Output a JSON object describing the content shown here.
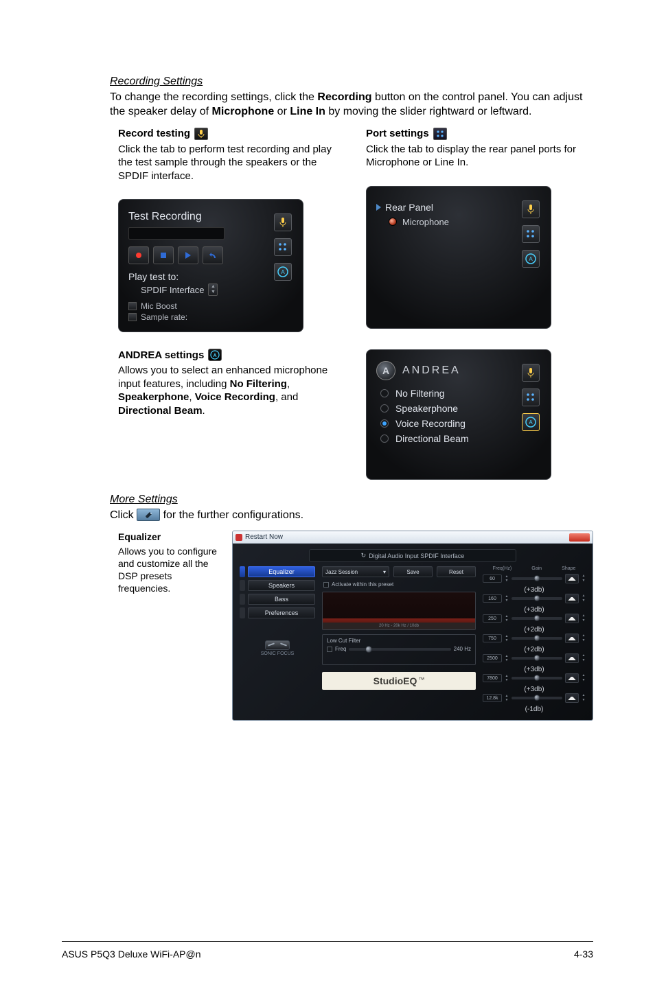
{
  "section1": {
    "title": "Recording Settings",
    "para_pre": "To change the recording settings, click the ",
    "para_b1": "Recording",
    "para_mid1": " button on the control panel. You can adjust the speaker delay of ",
    "para_b2": "Microphone",
    "para_mid2": " or ",
    "para_b3": "Line In",
    "para_post": " by moving the slider rightward or leftward."
  },
  "record": {
    "heading": "Record testing",
    "desc": "Click the tab to perform test recording and play the test sample through the speakers or the SPDIF interface.",
    "panel": {
      "title": "Test Recording",
      "play_label": "Play test to:",
      "play_value": "SPDIF Interface",
      "chk1": "Mic Boost",
      "chk2": "Sample rate:"
    }
  },
  "port": {
    "heading": "Port settings",
    "desc": "Click the tab to display the rear panel ports for Microphone or Line In.",
    "panel": {
      "title": "Rear Panel",
      "item": "Microphone"
    }
  },
  "andrea": {
    "heading": "ANDREA settings",
    "desc_pre": "Allows you to select an enhanced microphone input features, including ",
    "b1": "No Filtering",
    "sep1": ", ",
    "b2": "Speakerphone",
    "sep2": ", ",
    "b3": "Voice Recording",
    "sep3": ", and ",
    "b4": "Directional Beam",
    "post": ".",
    "logo_char": "A",
    "logo_text": "ANDREA",
    "options": [
      "No Filtering",
      "Speakerphone",
      "Voice Recording",
      "Directional Beam"
    ]
  },
  "more": {
    "title": "More Settings",
    "line_pre": "Click ",
    "line_post": " for the further configurations.",
    "eq": {
      "h": "Equalizer",
      "desc": "Allows you to configure and customize all the DSP presets frequencies."
    }
  },
  "eqwin": {
    "title": "Restart Now",
    "strip": "Digital Audio Input SPDIF Interface",
    "tabs": [
      "Equalizer",
      "Speakers",
      "Bass",
      "Preferences"
    ],
    "sonic": "SONIC FOCUS",
    "preset": "Jazz Session",
    "save": "Save",
    "reset": "Reset",
    "activate": "Activate within this preset",
    "axis": "20 Hz - 20k Hz / 10db",
    "lowcut": "Low Cut Filter",
    "lc_freq": "Freq",
    "lc_val": "240 Hz",
    "studio": "StudioEQ",
    "tm": "™",
    "hdr": {
      "f": "Freq(Hz)",
      "g": "Gain",
      "s": "Shape"
    },
    "bands": [
      {
        "f": "60",
        "db": "(+3db)"
      },
      {
        "f": "160",
        "db": "(+3db)"
      },
      {
        "f": "250",
        "db": "(+2db)"
      },
      {
        "f": "750",
        "db": "(+2db)"
      },
      {
        "f": "2500",
        "db": "(+3db)"
      },
      {
        "f": "7800",
        "db": "(+3db)"
      },
      {
        "f": "12.8k",
        "db": "(-1db)"
      }
    ]
  },
  "footer": {
    "left": "ASUS P5Q3 Deluxe WiFi-AP@n",
    "right": "4-33"
  }
}
